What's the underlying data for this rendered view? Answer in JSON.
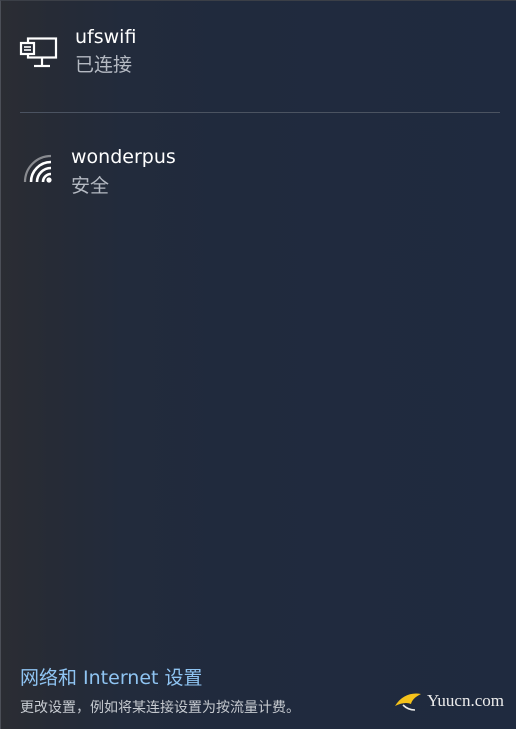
{
  "networks": [
    {
      "name": "ufswifi",
      "status": "已连接",
      "icon": "ethernet-monitor-icon"
    },
    {
      "name": "wonderpus",
      "status": "安全",
      "icon": "wifi-icon"
    }
  ],
  "settings": {
    "link_label": "网络和 Internet 设置",
    "description": "更改设置，例如将某连接设置为按流量计费。"
  },
  "watermark": {
    "text": "Yuucn.com",
    "icon": "bird-logo-icon"
  },
  "colors": {
    "background": "#1f2a3f",
    "link": "#8fc4f2",
    "secondary_text": "#b4b9c2",
    "divider": "#4b5361"
  }
}
